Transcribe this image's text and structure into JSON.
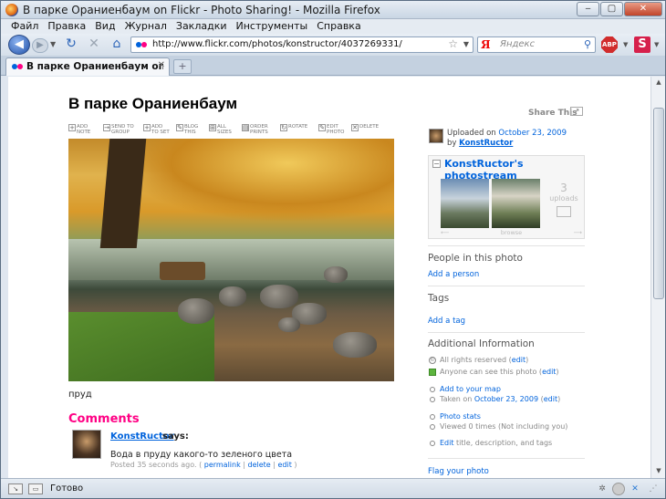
{
  "window": {
    "title": "В парке Ораниенбаум on Flickr - Photo Sharing! - Mozilla Firefox",
    "minimize": "‒",
    "maximize": "▢",
    "close": "✕"
  },
  "menu": [
    "Файл",
    "Правка",
    "Вид",
    "Журнал",
    "Закладки",
    "Инструменты",
    "Справка"
  ],
  "nav": {
    "url": "http://www.flickr.com/photos/konstructor/4037269331/",
    "search_placeholder": "Яндекс",
    "search_engine_glyph": "Я",
    "abp_label": "ABP",
    "s_label": "S"
  },
  "tabs": [
    {
      "label": "В парке Ораниенбаум on Flickr - Pho..."
    }
  ],
  "page": {
    "title": "В парке Ораниенбаум",
    "share_label": "Share This",
    "tools": [
      {
        "icon": "add-note-icon",
        "label": "ADD NOTE"
      },
      {
        "icon": "send-to-group-icon",
        "label": "SEND TO GROUP"
      },
      {
        "icon": "add-to-set-icon",
        "label": "ADD TO SET"
      },
      {
        "icon": "blog-this-icon",
        "label": "BLOG THIS"
      },
      {
        "icon": "all-sizes-icon",
        "label": "ALL SIZES"
      },
      {
        "icon": "order-prints-icon",
        "label": "ORDER PRINTS"
      },
      {
        "icon": "rotate-icon",
        "label": "ROTATE"
      },
      {
        "icon": "edit-photo-icon",
        "label": "EDIT PHOTO"
      },
      {
        "icon": "delete-icon",
        "label": "DELETE"
      }
    ],
    "caption": "пруд",
    "comments_heading": "Comments",
    "comment": {
      "author": "KonstRuctor",
      "says": "says:",
      "text": "Вода в пруду какого-то зеленого цвета",
      "posted_prefix": "Posted 35 seconds ago. (",
      "permalink": "permalink",
      "delete": "delete",
      "edit": "edit",
      "posted_suffix": ")"
    }
  },
  "sidebar": {
    "uploaded_prefix": "Uploaded on",
    "uploaded_date": "October 23, 2009",
    "by_prefix": "by",
    "by_user": "KonstRuctor",
    "photostream_title": "KonstRuctor's photostream",
    "uploads_count": "3",
    "uploads_label": "uploads",
    "browse_label": "browse",
    "people_heading": "People in this photo",
    "add_person": "Add a person",
    "tags_heading": "Tags",
    "add_tag": "Add a tag",
    "additional_heading": "Additional Information",
    "rights_text": "All rights reserved",
    "rights_edit": "edit",
    "visibility_text": "Anyone can see this photo",
    "visibility_edit": "edit",
    "add_to_map": "Add to your map",
    "taken_prefix": "Taken on",
    "taken_date": "October 23, 2009",
    "taken_edit": "edit",
    "photo_stats": "Photo stats",
    "viewed_text": "Viewed 0 times  (Not including you)",
    "edit_link": "Edit",
    "edit_rest": "title, description, and tags",
    "flag": "Flag your photo"
  },
  "status": {
    "text": "Готово"
  }
}
